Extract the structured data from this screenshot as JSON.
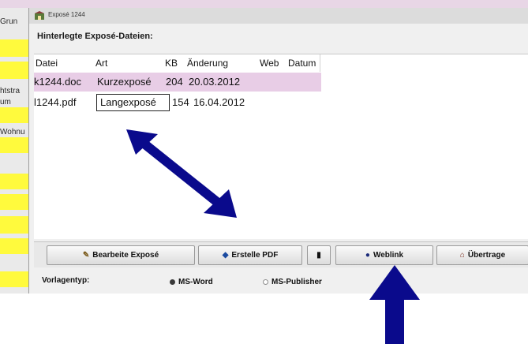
{
  "window": {
    "title": "Exposé 1244"
  },
  "left_panel": {
    "labels": [
      "Grun",
      "htstra",
      "um",
      "Wohnu"
    ]
  },
  "section_title": "Hinterlegte Exposé-Dateien:",
  "table": {
    "headers": [
      "Datei",
      "Art",
      "KB",
      "Änderung",
      "Web",
      "Datum"
    ],
    "rows": [
      {
        "datei": "k1244.doc",
        "art": "Kurzexposé",
        "kb": "204",
        "aenderung": "20.03.2012",
        "selected": true
      },
      {
        "datei": "l1244.pdf",
        "art": "Langexposé",
        "kb": "154",
        "aenderung": "16.04.2012",
        "selected": false
      }
    ]
  },
  "buttons": {
    "edit": "Bearbeite Exposé",
    "pdf": "Erstelle PDF",
    "weblink": "Weblink",
    "transfer": "Übertrage"
  },
  "footer": {
    "label": "Vorlagentyp:",
    "option_word": "MS-Word",
    "option_publisher": "MS-Publisher",
    "selected": "MS-Word"
  },
  "colors": {
    "selection": "#e8cde6",
    "yellow": "#fffa3d",
    "arrow": "#0a0a8c"
  }
}
